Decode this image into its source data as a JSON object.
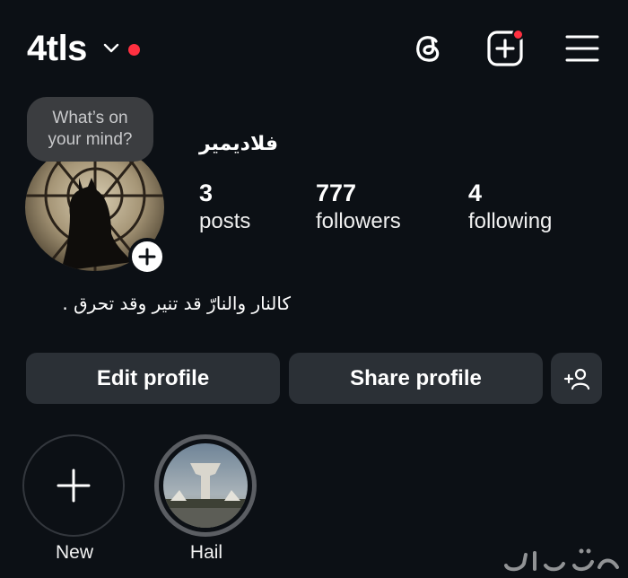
{
  "header": {
    "username": "4tls",
    "icons": [
      "chevron-down-icon",
      "threads-icon",
      "create-post-icon",
      "menu-icon"
    ],
    "notification_dot_color": "#ff3040"
  },
  "profile": {
    "note": {
      "line1": "What’s on",
      "line2": "your mind?"
    },
    "display_name": "فلاديمير",
    "stats": [
      {
        "value": "3",
        "label": "posts"
      },
      {
        "value": "777",
        "label": "followers"
      },
      {
        "value": "4",
        "label": "following"
      }
    ],
    "bio": "كالنار والنارّ قد تنير وقد تحرق ."
  },
  "actions": {
    "edit_label": "Edit profile",
    "share_label": "Share profile",
    "add_person_icon": "add-person-icon"
  },
  "highlights": [
    {
      "label": "New",
      "icon": "plus-icon"
    },
    {
      "label": "Hail"
    }
  ],
  "watermark": {
    "text": "حراج"
  },
  "colors": {
    "background": "#0c1015",
    "button": "#2b3036",
    "note_bubble": "#3b3d40",
    "accent_red": "#ff3040"
  }
}
